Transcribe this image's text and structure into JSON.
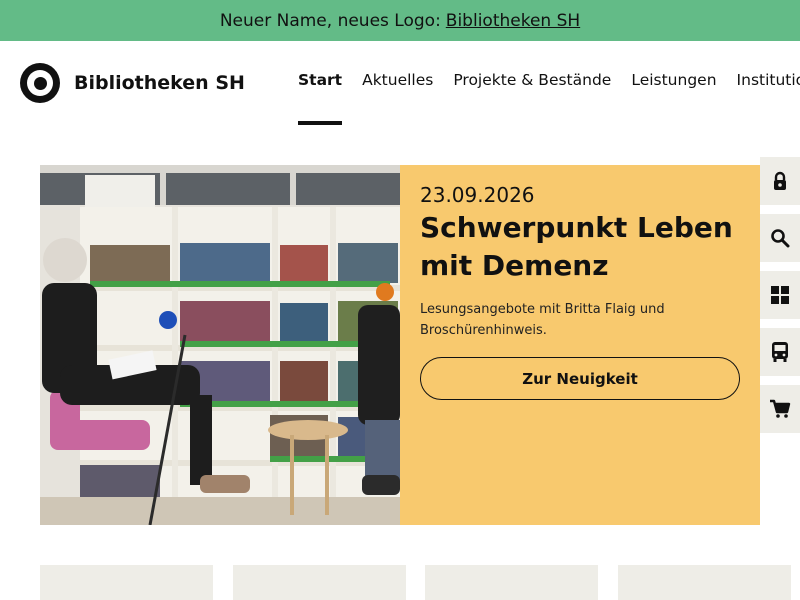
{
  "banner": {
    "prefix": "Neuer Name, neues Logo:",
    "link": "Bibliotheken SH"
  },
  "header": {
    "brand": "Bibliotheken SH",
    "nav": [
      {
        "label": "Start",
        "active": true
      },
      {
        "label": "Aktuelles",
        "active": false
      },
      {
        "label": "Projekte & Bestände",
        "active": false
      },
      {
        "label": "Leistungen",
        "active": false
      },
      {
        "label": "Institutionen",
        "active": false
      }
    ]
  },
  "hero": {
    "date": "23.09.2026",
    "headline": "Schwerpunkt Leben mit Demenz",
    "teaser": "Lesungsangebote mit Britta Flaig und Broschürenhinweis.",
    "button": "Zur Neuigkeit",
    "image_alt": "photo-reading-event-library"
  },
  "side_tools": [
    "lock-icon",
    "search-icon",
    "grid-icon",
    "bus-icon",
    "cart-icon"
  ],
  "colors": {
    "banner": "#63bb87",
    "panel": "#f8c96e",
    "tool_bg": "#eeede7",
    "text": "#111111"
  }
}
